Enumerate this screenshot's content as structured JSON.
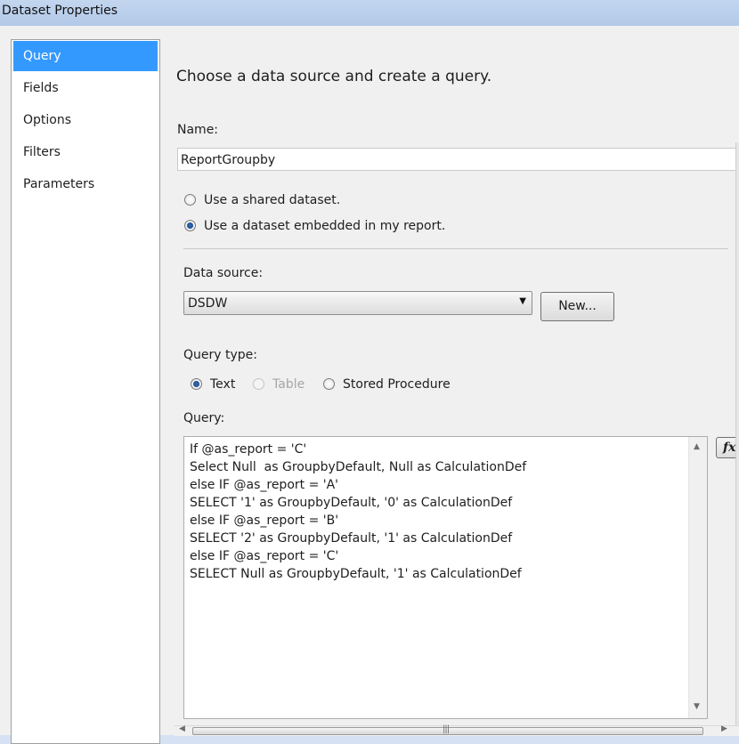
{
  "window": {
    "title": "Dataset Properties"
  },
  "nav": {
    "items": [
      {
        "label": "Query",
        "selected": true
      },
      {
        "label": "Fields",
        "selected": false
      },
      {
        "label": "Options",
        "selected": false
      },
      {
        "label": "Filters",
        "selected": false
      },
      {
        "label": "Parameters",
        "selected": false
      }
    ]
  },
  "main": {
    "heading": "Choose a data source and create a query.",
    "name_label": "Name:",
    "name_value": "ReportGroupby",
    "dataset_options": [
      {
        "label": "Use a shared dataset.",
        "selected": false
      },
      {
        "label": "Use a dataset embedded in my report.",
        "selected": true
      }
    ],
    "data_source_label": "Data source:",
    "data_source_value": "DSDW",
    "new_button": "New...",
    "query_type_label": "Query type:",
    "query_types": [
      {
        "label": "Text",
        "selected": true,
        "enabled": true
      },
      {
        "label": "Table",
        "selected": false,
        "enabled": false
      },
      {
        "label": "Stored Procedure",
        "selected": false,
        "enabled": true
      }
    ],
    "query_label": "Query:",
    "query_lines": [
      "If @as_report = 'C'",
      "Select Null  as GroupbyDefault, Null as CalculationDef",
      "else IF @as_report = 'A'",
      "SELECT '1' as GroupbyDefault, '0' as CalculationDef",
      "else IF @as_report = 'B'",
      "SELECT '2' as GroupbyDefault, '1' as CalculationDef",
      "else IF @as_report = 'C'",
      "SELECT Null as GroupbyDefault, '1' as CalculationDef"
    ],
    "expression_button": "fx"
  }
}
